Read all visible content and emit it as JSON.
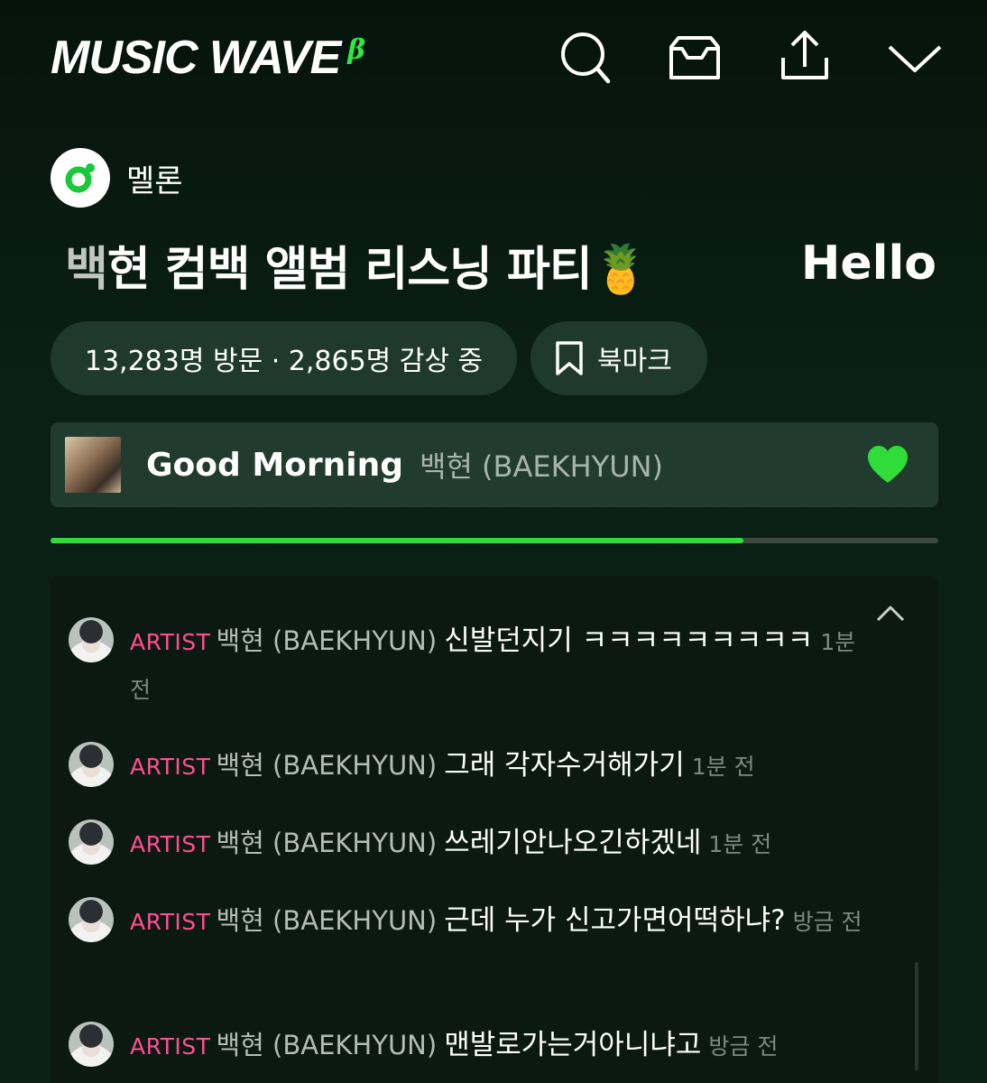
{
  "header": {
    "brand": "MUSIC WAVE",
    "beta": "β",
    "icons": [
      "search-icon",
      "inbox-icon",
      "share-icon",
      "chevron-down-icon"
    ]
  },
  "source": {
    "name": "멜론",
    "logo": "melon-logo"
  },
  "room": {
    "title_faded": "백",
    "title_rest": "현 컴백 앨범 리스닝 파티",
    "emoji": "🍍",
    "hello": "Hello"
  },
  "stats": {
    "text": "13,283명 방문 · 2,865명 감상 중"
  },
  "bookmark": {
    "label": "북마크",
    "icon": "bookmark-icon"
  },
  "now_playing": {
    "title": "Good Morning",
    "artist": "백현 (BAEKHYUN)",
    "liked": true,
    "progress": 0.78
  },
  "colors": {
    "accent": "#2fdc3a",
    "artist_tag": "#ff4f92",
    "background": "#0b2116"
  },
  "messages": [
    {
      "tag": "ARTIST",
      "author": "백현 (BAEKHYUN)",
      "text": "신발던지기 ㅋㅋㅋㅋㅋㅋㅋㅋㅋ",
      "time": "1분 전"
    },
    {
      "tag": "ARTIST",
      "author": "백현 (BAEKHYUN)",
      "text": "그래 각자수거해가기",
      "time": "1분 전"
    },
    {
      "tag": "ARTIST",
      "author": "백현 (BAEKHYUN)",
      "text": "쓰레기안나오긴하겠네",
      "time": "1분 전"
    },
    {
      "tag": "ARTIST",
      "author": "백현 (BAEKHYUN)",
      "text": "근데 누가 신고가면어떡하냐?",
      "time": "방금 전"
    },
    {
      "tag": "ARTIST",
      "author": "백현 (BAEKHYUN)",
      "text": "맨발로가는거아니냐고",
      "time": "방금 전"
    }
  ]
}
